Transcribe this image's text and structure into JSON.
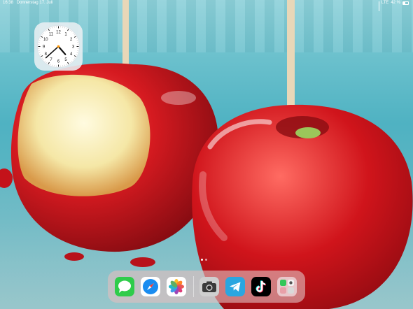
{
  "status_bar": {
    "time": "16:38",
    "date": "Donnerstag 17. Juli",
    "network": "LTE",
    "battery_percent": "42 %",
    "battery_level": 0.42
  },
  "clock_widget": {
    "numerals": [
      "12",
      "1",
      "2",
      "3",
      "4",
      "5",
      "6",
      "7",
      "8",
      "9",
      "10",
      "11"
    ],
    "time_shown": "16:38"
  },
  "wallpaper": {
    "subject": "candy-apples",
    "colors": {
      "background": "#6fc3cf",
      "apple": "#c4121a"
    }
  },
  "home": {
    "page_count": 2,
    "current_page": 1
  },
  "dock": {
    "apps": [
      {
        "name": "Messages",
        "icon": "messages-icon",
        "color": "#2fcc4a"
      },
      {
        "name": "Safari",
        "icon": "safari-icon",
        "color": "#1a8cf0"
      },
      {
        "name": "Photos",
        "icon": "photos-icon",
        "color": "#ffffff"
      },
      {
        "name": "Camera",
        "icon": "camera-icon",
        "color": "#c8c8c8"
      },
      {
        "name": "Telegram",
        "icon": "telegram-icon",
        "color": "#2aa6e0"
      },
      {
        "name": "TikTok",
        "icon": "tiktok-icon",
        "color": "#000000"
      },
      {
        "name": "App Library",
        "icon": "app-library-icon",
        "color": "#e9c6ca"
      }
    ]
  }
}
